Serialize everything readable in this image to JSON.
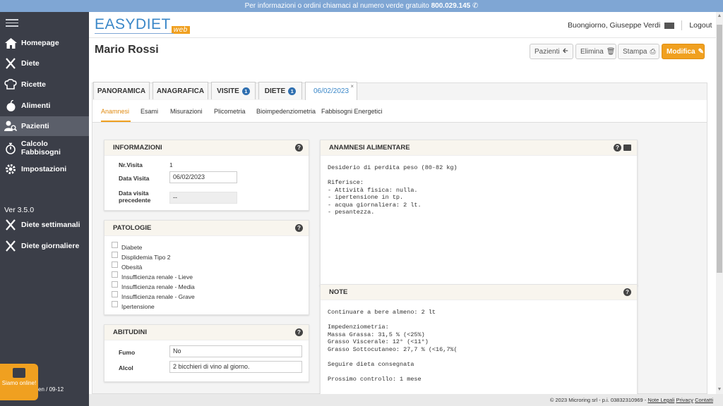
{
  "topbar": {
    "text": "Per informazioni o ordini chiamaci al numero verde gratuito",
    "phone": "800.029.145"
  },
  "sidebar": {
    "items": [
      {
        "label": "Homepage",
        "icon": "home-icon"
      },
      {
        "label": "Diete",
        "icon": "fork-knife-icon"
      },
      {
        "label": "Ricette",
        "icon": "chef-hat-icon"
      },
      {
        "label": "Alimenti",
        "icon": "apple-icon"
      },
      {
        "label": "Pazienti",
        "icon": "patient-icon"
      },
      {
        "label": "Calcolo Fabbisogni",
        "icon": "stopwatch-icon"
      },
      {
        "label": "Impostazioni",
        "icon": "gear-icon"
      }
    ],
    "version": "Ver 3.5.0",
    "extra_items": [
      {
        "label": "Diete settimanali",
        "icon": "fork-knife-icon"
      },
      {
        "label": "Diete giornaliere",
        "icon": "fork-knife-icon"
      }
    ],
    "chat_label": "Siamo online!",
    "footer_text": "en / 09-12"
  },
  "header": {
    "logo_main": "EASYDIET",
    "logo_badge": "web",
    "greeting": "Buongiorno, Giuseppe Verdi",
    "logout": "Logout"
  },
  "page": {
    "title": "Mario Rossi",
    "buttons": {
      "pazienti": "Pazienti",
      "elimina": "Elimina",
      "stampa": "Stampa",
      "modifica": "Modifica"
    }
  },
  "tabs": [
    {
      "label": "PANORAMICA"
    },
    {
      "label": "ANAGRAFICA"
    },
    {
      "label": "VISITE",
      "count": "1"
    },
    {
      "label": "DIETE",
      "count": "1"
    },
    {
      "label": "06/02/2023",
      "close": "×"
    }
  ],
  "subtabs": [
    "Anamnesi",
    "Esami",
    "Misurazioni",
    "Plicometria",
    "Bioimpedenziometria",
    "Fabbisogni Energetici"
  ],
  "informazioni": {
    "title": "INFORMAZIONI",
    "nr_visita_label": "Nr.Visita",
    "nr_visita": "1",
    "data_visita_label": "Data Visita",
    "data_visita": "06/02/2023",
    "data_prec_label": "Data visita precedente",
    "data_prec": "--"
  },
  "patologie": {
    "title": "PATOLOGIE",
    "items": [
      "Diabete",
      "Displidemia Tipo 2",
      "Obesità",
      "Insufficienza renale - Lieve",
      "Insufficienza renale - Media",
      "Insufficienza renale - Grave",
      "Ipertensione"
    ]
  },
  "abitudini": {
    "title": "ABITUDINI",
    "fumo_label": "Fumo",
    "fumo": "No",
    "alcol_label": "Alcol",
    "alcol": "2 bicchieri di vino al giorno."
  },
  "anamnesi": {
    "title": "ANAMNESI ALIMENTARE",
    "text": "Desiderio di perdita peso (80-82 kg)\n\nRiferisce:\n- Attività fisica: nulla.\n- ipertensione in tp.\n- acqua giornaliera: 2 lt.\n- pesantezza."
  },
  "note": {
    "title": "NOTE",
    "text": "Continuare a bere almeno: 2 lt\n\nImpedenziometria:\nMassa Grassa: 31,5 % (<25%)\nGrasso Viscerale: 12° (<11°)\nGrasso Sottocutaneo: 27,7 % (<16,7%(\n\nSeguire dieta consegnata\n\nProssimo controllo: 1 mese"
  },
  "footer": {
    "copyright": "© 2023 Microring srl - p.i. 03832310969 -",
    "links": [
      "Note Legali",
      "Privacy",
      "Contatti"
    ]
  },
  "colors": {
    "accent": "#f0a020",
    "brand_blue": "#3a87c8",
    "sidebar": "#3b3e48"
  }
}
